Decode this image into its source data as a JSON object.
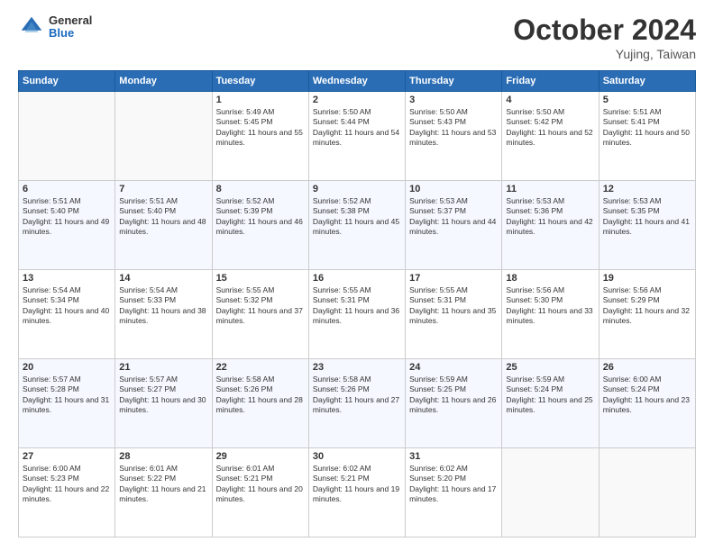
{
  "header": {
    "logo": {
      "general": "General",
      "blue": "Blue"
    },
    "title": "October 2024",
    "location": "Yujing, Taiwan"
  },
  "weekdays": [
    "Sunday",
    "Monday",
    "Tuesday",
    "Wednesday",
    "Thursday",
    "Friday",
    "Saturday"
  ],
  "weeks": [
    [
      {
        "day": "",
        "empty": true
      },
      {
        "day": "",
        "empty": true
      },
      {
        "day": "1",
        "sunrise": "Sunrise: 5:49 AM",
        "sunset": "Sunset: 5:45 PM",
        "daylight": "Daylight: 11 hours and 55 minutes."
      },
      {
        "day": "2",
        "sunrise": "Sunrise: 5:50 AM",
        "sunset": "Sunset: 5:44 PM",
        "daylight": "Daylight: 11 hours and 54 minutes."
      },
      {
        "day": "3",
        "sunrise": "Sunrise: 5:50 AM",
        "sunset": "Sunset: 5:43 PM",
        "daylight": "Daylight: 11 hours and 53 minutes."
      },
      {
        "day": "4",
        "sunrise": "Sunrise: 5:50 AM",
        "sunset": "Sunset: 5:42 PM",
        "daylight": "Daylight: 11 hours and 52 minutes."
      },
      {
        "day": "5",
        "sunrise": "Sunrise: 5:51 AM",
        "sunset": "Sunset: 5:41 PM",
        "daylight": "Daylight: 11 hours and 50 minutes."
      }
    ],
    [
      {
        "day": "6",
        "sunrise": "Sunrise: 5:51 AM",
        "sunset": "Sunset: 5:40 PM",
        "daylight": "Daylight: 11 hours and 49 minutes."
      },
      {
        "day": "7",
        "sunrise": "Sunrise: 5:51 AM",
        "sunset": "Sunset: 5:40 PM",
        "daylight": "Daylight: 11 hours and 48 minutes."
      },
      {
        "day": "8",
        "sunrise": "Sunrise: 5:52 AM",
        "sunset": "Sunset: 5:39 PM",
        "daylight": "Daylight: 11 hours and 46 minutes."
      },
      {
        "day": "9",
        "sunrise": "Sunrise: 5:52 AM",
        "sunset": "Sunset: 5:38 PM",
        "daylight": "Daylight: 11 hours and 45 minutes."
      },
      {
        "day": "10",
        "sunrise": "Sunrise: 5:53 AM",
        "sunset": "Sunset: 5:37 PM",
        "daylight": "Daylight: 11 hours and 44 minutes."
      },
      {
        "day": "11",
        "sunrise": "Sunrise: 5:53 AM",
        "sunset": "Sunset: 5:36 PM",
        "daylight": "Daylight: 11 hours and 42 minutes."
      },
      {
        "day": "12",
        "sunrise": "Sunrise: 5:53 AM",
        "sunset": "Sunset: 5:35 PM",
        "daylight": "Daylight: 11 hours and 41 minutes."
      }
    ],
    [
      {
        "day": "13",
        "sunrise": "Sunrise: 5:54 AM",
        "sunset": "Sunset: 5:34 PM",
        "daylight": "Daylight: 11 hours and 40 minutes."
      },
      {
        "day": "14",
        "sunrise": "Sunrise: 5:54 AM",
        "sunset": "Sunset: 5:33 PM",
        "daylight": "Daylight: 11 hours and 38 minutes."
      },
      {
        "day": "15",
        "sunrise": "Sunrise: 5:55 AM",
        "sunset": "Sunset: 5:32 PM",
        "daylight": "Daylight: 11 hours and 37 minutes."
      },
      {
        "day": "16",
        "sunrise": "Sunrise: 5:55 AM",
        "sunset": "Sunset: 5:31 PM",
        "daylight": "Daylight: 11 hours and 36 minutes."
      },
      {
        "day": "17",
        "sunrise": "Sunrise: 5:55 AM",
        "sunset": "Sunset: 5:31 PM",
        "daylight": "Daylight: 11 hours and 35 minutes."
      },
      {
        "day": "18",
        "sunrise": "Sunrise: 5:56 AM",
        "sunset": "Sunset: 5:30 PM",
        "daylight": "Daylight: 11 hours and 33 minutes."
      },
      {
        "day": "19",
        "sunrise": "Sunrise: 5:56 AM",
        "sunset": "Sunset: 5:29 PM",
        "daylight": "Daylight: 11 hours and 32 minutes."
      }
    ],
    [
      {
        "day": "20",
        "sunrise": "Sunrise: 5:57 AM",
        "sunset": "Sunset: 5:28 PM",
        "daylight": "Daylight: 11 hours and 31 minutes."
      },
      {
        "day": "21",
        "sunrise": "Sunrise: 5:57 AM",
        "sunset": "Sunset: 5:27 PM",
        "daylight": "Daylight: 11 hours and 30 minutes."
      },
      {
        "day": "22",
        "sunrise": "Sunrise: 5:58 AM",
        "sunset": "Sunset: 5:26 PM",
        "daylight": "Daylight: 11 hours and 28 minutes."
      },
      {
        "day": "23",
        "sunrise": "Sunrise: 5:58 AM",
        "sunset": "Sunset: 5:26 PM",
        "daylight": "Daylight: 11 hours and 27 minutes."
      },
      {
        "day": "24",
        "sunrise": "Sunrise: 5:59 AM",
        "sunset": "Sunset: 5:25 PM",
        "daylight": "Daylight: 11 hours and 26 minutes."
      },
      {
        "day": "25",
        "sunrise": "Sunrise: 5:59 AM",
        "sunset": "Sunset: 5:24 PM",
        "daylight": "Daylight: 11 hours and 25 minutes."
      },
      {
        "day": "26",
        "sunrise": "Sunrise: 6:00 AM",
        "sunset": "Sunset: 5:24 PM",
        "daylight": "Daylight: 11 hours and 23 minutes."
      }
    ],
    [
      {
        "day": "27",
        "sunrise": "Sunrise: 6:00 AM",
        "sunset": "Sunset: 5:23 PM",
        "daylight": "Daylight: 11 hours and 22 minutes."
      },
      {
        "day": "28",
        "sunrise": "Sunrise: 6:01 AM",
        "sunset": "Sunset: 5:22 PM",
        "daylight": "Daylight: 11 hours and 21 minutes."
      },
      {
        "day": "29",
        "sunrise": "Sunrise: 6:01 AM",
        "sunset": "Sunset: 5:21 PM",
        "daylight": "Daylight: 11 hours and 20 minutes."
      },
      {
        "day": "30",
        "sunrise": "Sunrise: 6:02 AM",
        "sunset": "Sunset: 5:21 PM",
        "daylight": "Daylight: 11 hours and 19 minutes."
      },
      {
        "day": "31",
        "sunrise": "Sunrise: 6:02 AM",
        "sunset": "Sunset: 5:20 PM",
        "daylight": "Daylight: 11 hours and 17 minutes."
      },
      {
        "day": "",
        "empty": true
      },
      {
        "day": "",
        "empty": true
      }
    ]
  ]
}
